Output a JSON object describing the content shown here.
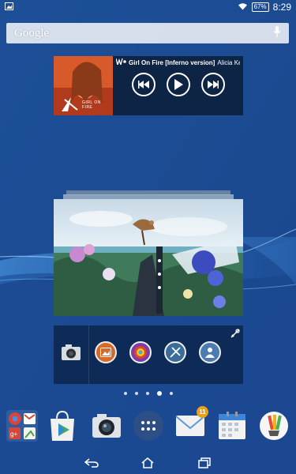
{
  "status_bar": {
    "battery_percent": "67",
    "time": "8:29",
    "icons": [
      "picture-icon",
      "wifi-icon",
      "battery-icon"
    ]
  },
  "search": {
    "label": "Google"
  },
  "music_widget": {
    "track_title": "Girl On Fire [Inferno version]",
    "artist": "Alicia Keys F",
    "album_art_text": "GIRL ON FIRE"
  },
  "dock": {
    "email_badge_count": "11"
  },
  "page_indicator": {
    "count": 5,
    "active_index": 3
  },
  "colors": {
    "wallpaper": "#1a4d9a",
    "widget_bg": "#0d2444",
    "badge": "#e9a11a"
  }
}
